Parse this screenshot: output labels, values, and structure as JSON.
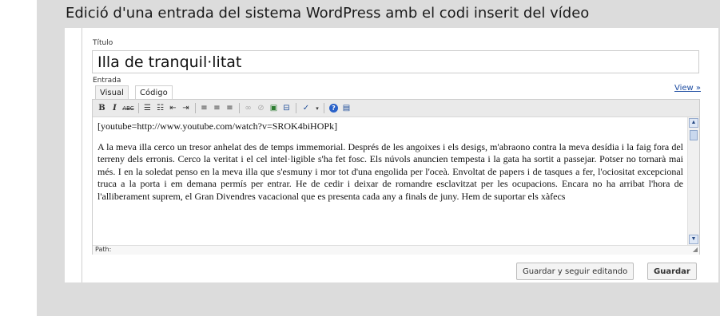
{
  "caption": "Edició d'una entrada del sistema WordPress amb el codi inserit del vídeo",
  "form": {
    "title_label": "Título",
    "title_value": "Illa de tranquil·litat",
    "entry_label": "Entrada",
    "view_link": "View »",
    "tabs": [
      {
        "label": "Visual",
        "active": true
      },
      {
        "label": "Código",
        "active": false
      }
    ]
  },
  "toolbar": {
    "buttons": [
      {
        "name": "bold",
        "glyph": "B"
      },
      {
        "name": "italic",
        "glyph": "I"
      },
      {
        "name": "strikethrough",
        "glyph": "ABC"
      },
      {
        "name": "bullet-list",
        "glyph": "☰"
      },
      {
        "name": "numbered-list",
        "glyph": "☷"
      },
      {
        "name": "outdent",
        "glyph": "⇤"
      },
      {
        "name": "indent",
        "glyph": "⇥"
      },
      {
        "name": "align-left",
        "glyph": "≡"
      },
      {
        "name": "align-center",
        "glyph": "≡"
      },
      {
        "name": "align-right",
        "glyph": "≡"
      },
      {
        "name": "link",
        "glyph": "∞"
      },
      {
        "name": "unlink",
        "glyph": "⊘"
      },
      {
        "name": "insert-image",
        "glyph": "▣"
      },
      {
        "name": "insert-more",
        "glyph": "⊟"
      },
      {
        "name": "spellcheck",
        "glyph": "✓"
      },
      {
        "name": "help",
        "glyph": "?"
      },
      {
        "name": "kitchen-sink",
        "glyph": "▤"
      }
    ]
  },
  "editor": {
    "embed_code": "[youtube=http://www.youtube.com/watch?v=SROK4biHOPk]",
    "body_text": "A la meva illa cerco un tresor anhelat des de temps immemorial. Després de les angoixes i els desigs, m'abraono contra la meva desídia i la faig fora del terreny dels erronis. Cerco la veritat i el cel intel·ligible s'ha fet fosc. Els núvols anuncien tempesta i la gata ha sortit a passejar. Potser no tornarà mai més. I en la soledat penso en la meva illa que s'esmuny i mor tot d'una engolida per l'oceà. Envoltat de papers i de tasques a fer, l'ociositat excepcional truca a la porta i em demana permís per entrar. He de cedir i deixar de romandre esclavitzat per les ocupacions. Encara no ha arribat l'hora de l'alliberament suprem, el Gran Divendres vacacional que es presenta cada any a finals de juny. Hem de suportar els xàfecs",
    "path_label": "Path:"
  },
  "actions": {
    "save_continue": "Guardar y seguir editando",
    "save": "Guardar"
  }
}
